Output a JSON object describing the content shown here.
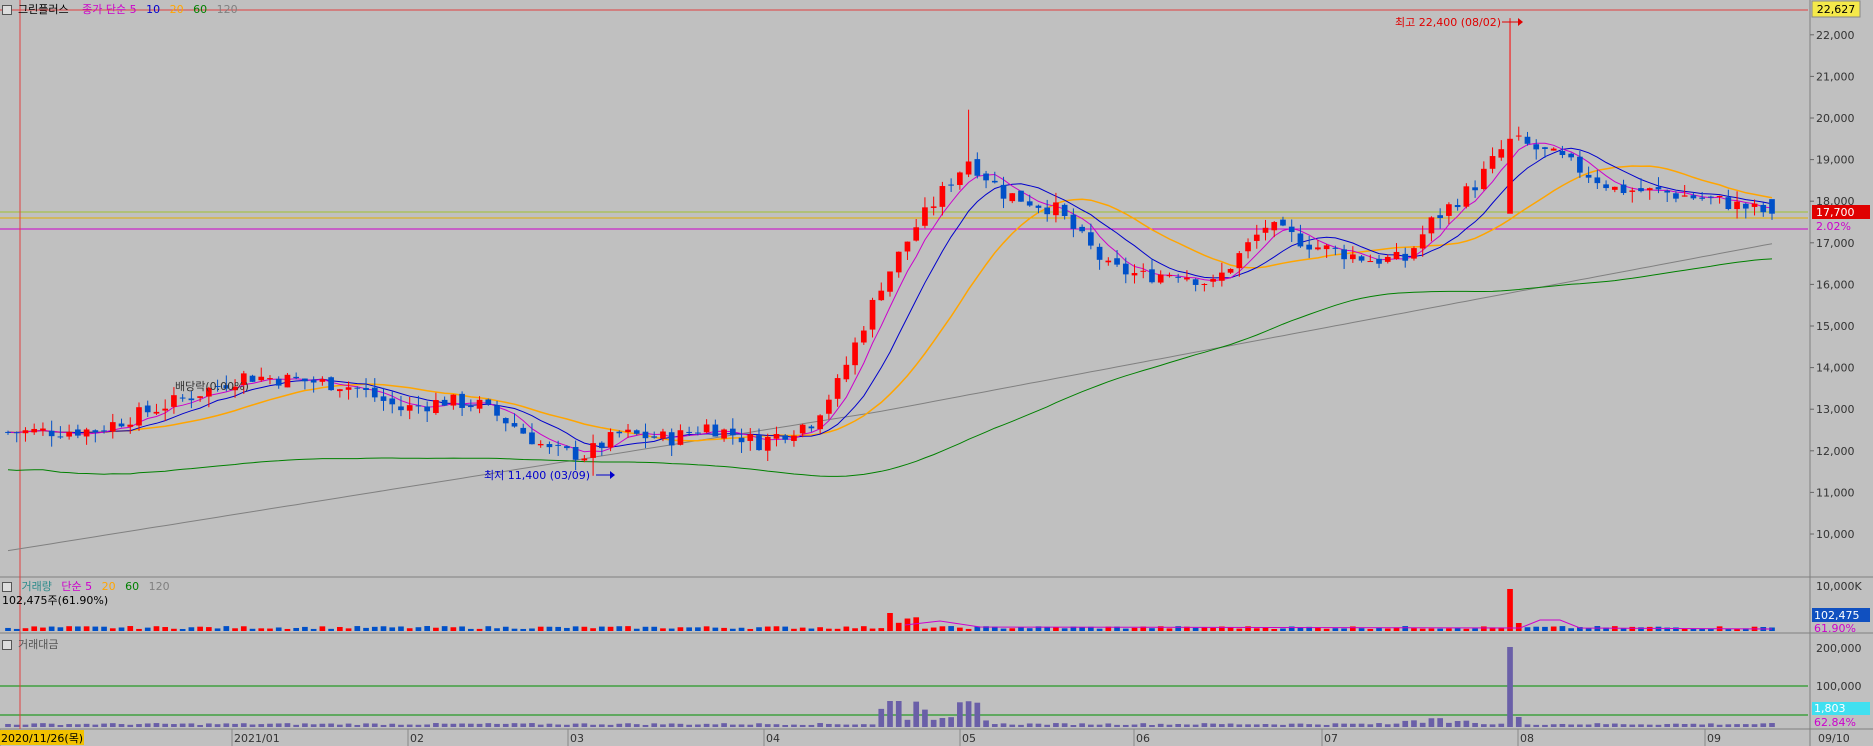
{
  "header": {
    "stock_name": "그린플러스",
    "price_legend": [
      {
        "label": "종가 단순 5",
        "color": "#cc00cc"
      },
      {
        "label": "10",
        "color": "#0000cc"
      },
      {
        "label": "20",
        "color": "#ffa500"
      },
      {
        "label": "60",
        "color": "#008000"
      },
      {
        "label": "120",
        "color": "#808080"
      }
    ],
    "volume_legend": [
      {
        "label": "거래량",
        "color": "#2a8a8a"
      },
      {
        "label": "단순 5",
        "color": "#cc00cc"
      },
      {
        "label": "20",
        "color": "#ffa500"
      },
      {
        "label": "60",
        "color": "#008000"
      },
      {
        "label": "120",
        "color": "#808080"
      }
    ],
    "volume_value": "102,475주(61.90%)",
    "amount_legend": "거래대금"
  },
  "chart_data": [
    {
      "type": "candlestick",
      "panel": "price",
      "y_ticks": [
        "22,000",
        "21,000",
        "20,000",
        "19,000",
        "18,000",
        "17,000",
        "16,000",
        "15,000",
        "14,000",
        "13,000",
        "12,000",
        "11,000",
        "10,000"
      ],
      "ylim": [
        9000,
        22600
      ],
      "x_ticks": [
        "2020/11/26(목)",
        "2021/01",
        "02",
        "03",
        "04",
        "05",
        "06",
        "07",
        "08",
        "09",
        "09/10"
      ],
      "annotations": {
        "high": "최고 22,400 (08/02)",
        "low": "최저 11,400 (03/09)",
        "dividend": "배당락(0.00%)",
        "top_badge": "22,627",
        "current_price": "17,700",
        "change_pct": "2.02%"
      },
      "colors": {
        "up": "#ff0000",
        "down": "#0050c8",
        "ma5": "#cc00cc",
        "ma10": "#0000cc",
        "ma20": "#ffa500",
        "ma60": "#008000",
        "ma120": "#808080"
      },
      "key_points": [
        {
          "date": "2020-11-26",
          "close": 12400
        },
        {
          "date": "2021-03-09",
          "low": 11400
        },
        {
          "date": "2021-05-07",
          "high": 20200
        },
        {
          "date": "2021-08-02",
          "high": 22400
        },
        {
          "date": "2021-09-10",
          "close": 17700
        }
      ]
    },
    {
      "type": "bar",
      "panel": "volume",
      "y_ticks": [
        "10,000K"
      ],
      "badges": [
        "102,475",
        "61.90%"
      ]
    },
    {
      "type": "bar",
      "panel": "trading_value",
      "y_ticks": [
        "200,000",
        "100,000"
      ],
      "badges": [
        "1,803",
        "62.84%"
      ]
    }
  ]
}
